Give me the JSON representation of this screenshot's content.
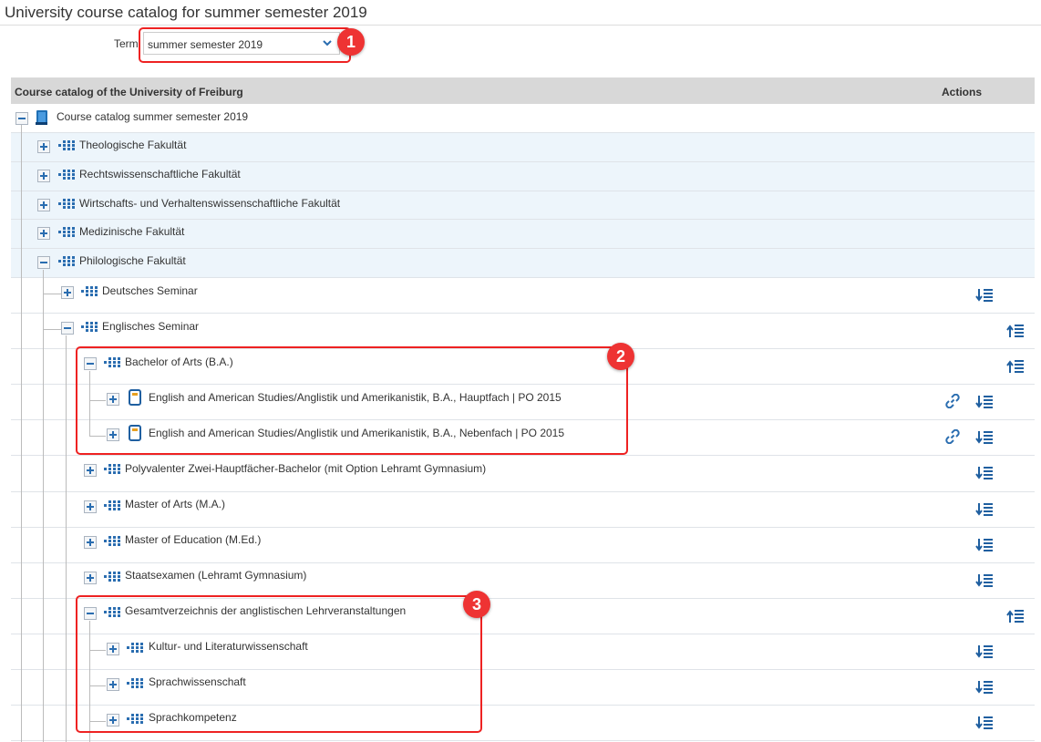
{
  "page_title": "University course catalog for summer semester 2019",
  "term": {
    "label": "Term",
    "value": "summer semester 2019"
  },
  "callouts": [
    "1",
    "2",
    "3"
  ],
  "table": {
    "col_catalog": "Course catalog of the University of Freiburg",
    "col_actions": "Actions"
  },
  "tree": {
    "root": "Course catalog summer semester 2019",
    "theologie": "Theologische Fakultät",
    "rechts": "Rechtswissenschaftliche Fakultät",
    "wirtschaft": "Wirtschafts- und Verhaltenswissenschaftliche Fakultät",
    "medizin": "Medizinische Fakultät",
    "philologie": "Philologische Fakultät",
    "deutsch": "Deutsches Seminar",
    "englisch": "Englisches Seminar",
    "ba": "Bachelor of Arts (B.A.)",
    "ba_haupt": "English and American Studies/Anglistik und Amerikanistik, B.A., Hauptfach | PO 2015",
    "ba_neben": "English and American Studies/Anglistik und Amerikanistik, B.A., Nebenfach | PO 2015",
    "poly": "Polyvalenter Zwei-Hauptfächer-Bachelor (mit Option Lehramt Gymnasium)",
    "ma": "Master of Arts (M.A.)",
    "med": "Master of Education (M.Ed.)",
    "staats": "Staatsexamen (Lehramt Gymnasium)",
    "gesamt": "Gesamtverzeichnis der anglistischen Lehrveranstaltungen",
    "kultur": "Kultur- und Literaturwissenschaft",
    "sprachw": "Sprachwissenschaft",
    "sprachk": "Sprachkompetenz"
  },
  "colors": {
    "accent": "#2a6db0",
    "callout": "#e33333",
    "header_bg": "#d8d8d8",
    "row_tint": "#edf5fb"
  },
  "icons": [
    "plus-icon",
    "minus-icon",
    "catalog-book-icon",
    "org-unit-icon",
    "study-program-icon",
    "link-icon",
    "expand-sort-icon",
    "collapse-sort-icon",
    "chevron-down-icon"
  ]
}
